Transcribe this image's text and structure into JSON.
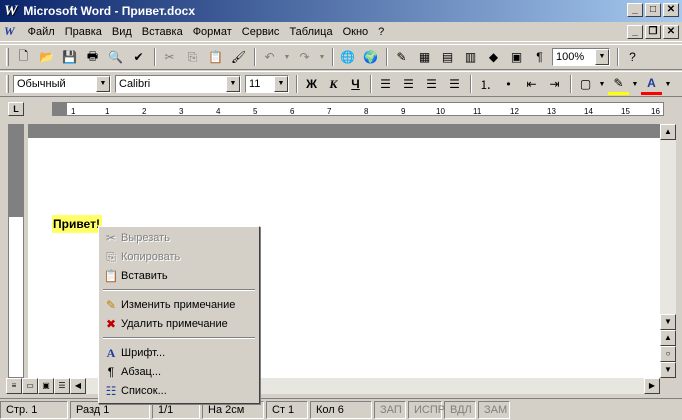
{
  "window": {
    "title": "Microsoft Word - Привет.docx"
  },
  "menu": [
    {
      "label": "Файл"
    },
    {
      "label": "Правка"
    },
    {
      "label": "Вид"
    },
    {
      "label": "Вставка"
    },
    {
      "label": "Формат"
    },
    {
      "label": "Сервис"
    },
    {
      "label": "Таблица"
    },
    {
      "label": "Окно"
    },
    {
      "label": "?"
    }
  ],
  "toolbar": {
    "zoom": "100%"
  },
  "format": {
    "style": "Обычный",
    "font": "Calibri",
    "size": "11",
    "bold": "Ж",
    "italic": "К",
    "underline": "Ч"
  },
  "ruler": {
    "ticks": [
      "1",
      "1",
      "2",
      "3",
      "4",
      "5",
      "6",
      "7",
      "8",
      "9",
      "10",
      "11",
      "12",
      "13",
      "14",
      "15",
      "16"
    ]
  },
  "document": {
    "text": "Привет!"
  },
  "context_menu": {
    "items": [
      {
        "label": "Вырезать",
        "icon": "scissors-icon",
        "enabled": false
      },
      {
        "label": "Копировать",
        "icon": "copy-icon",
        "enabled": false
      },
      {
        "label": "Вставить",
        "icon": "paste-icon",
        "enabled": true
      },
      {
        "label": "Изменить примечание",
        "icon": "edit-comment-icon",
        "enabled": true
      },
      {
        "label": "Удалить примечание",
        "icon": "delete-comment-icon",
        "enabled": true
      },
      {
        "label": "Шрифт...",
        "icon": "font-icon",
        "enabled": true
      },
      {
        "label": "Абзац...",
        "icon": "paragraph-icon",
        "enabled": true
      },
      {
        "label": "Список...",
        "icon": "list-icon",
        "enabled": true
      }
    ]
  },
  "status": {
    "page": "Стр. 1",
    "section": "Разд 1",
    "pages": "1/1",
    "at": "На 2см",
    "line": "Ст 1",
    "col": "Кол 6",
    "rec": "ЗАП",
    "trk": "ИСПР",
    "ext": "ВДЛ",
    "ovr": "ЗАМ"
  }
}
